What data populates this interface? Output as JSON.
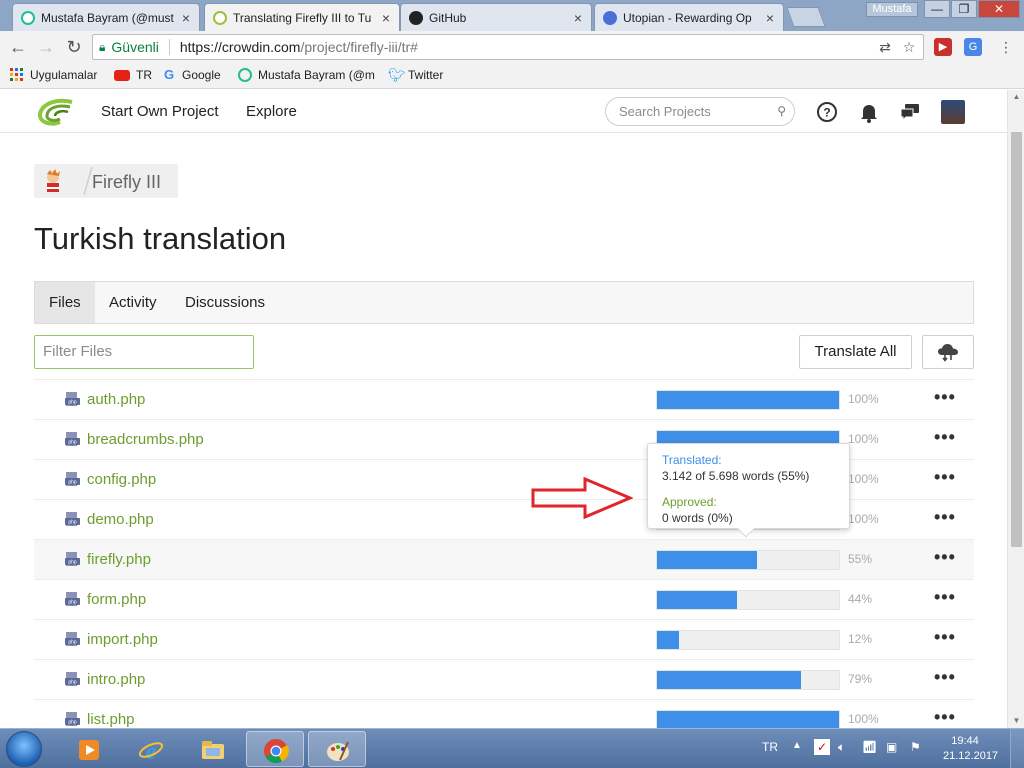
{
  "browser": {
    "tabs": [
      {
        "title": "Mustafa Bayram (@must",
        "favicon": "steemit-icon",
        "active": false
      },
      {
        "title": "Translating Firefly III to Tu",
        "favicon": "crowdin-icon",
        "active": true
      },
      {
        "title": "GitHub",
        "favicon": "github-icon",
        "active": false
      },
      {
        "title": "Utopian - Rewarding Op",
        "favicon": "utopian-icon",
        "active": false
      }
    ],
    "close_glyph": "×",
    "user_chip": "Mustafa",
    "window_buttons": [
      "—",
      "❐",
      "✕"
    ],
    "nav": {
      "back": "←",
      "forward": "→",
      "reload": "↻"
    },
    "address": {
      "secure_label": "Güvenli",
      "url_host": "https://crowdin.com",
      "url_path": "/project/firefly-iii/tr#"
    },
    "bookmarks": [
      {
        "label": "Uygulamalar",
        "icon": "apps-grid-icon"
      },
      {
        "label": "TR",
        "icon": "youtube-icon"
      },
      {
        "label": "Google",
        "icon": "google-icon"
      },
      {
        "label": "Mustafa Bayram (@m",
        "icon": "steemit-icon"
      },
      {
        "label": "Twitter",
        "icon": "twitter-icon"
      }
    ]
  },
  "site": {
    "nav": {
      "start_project": "Start Own Project",
      "explore": "Explore"
    },
    "search": {
      "placeholder": "Search Projects"
    },
    "breadcrumb": {
      "project": "Firefly III"
    },
    "page_title": "Turkish translation",
    "tabs": [
      {
        "label": "Files",
        "active": true
      },
      {
        "label": "Activity",
        "active": false
      },
      {
        "label": "Discussions",
        "active": false
      }
    ],
    "filter": {
      "placeholder": "Filter Files"
    },
    "translate_all": "Translate All",
    "files": [
      {
        "name": "auth.php",
        "progress": 100,
        "pct_label": "100%"
      },
      {
        "name": "breadcrumbs.php",
        "progress": 100,
        "pct_label": "100%"
      },
      {
        "name": "config.php",
        "progress": 100,
        "pct_label": "100%"
      },
      {
        "name": "demo.php",
        "progress": 100,
        "pct_label": "100%"
      },
      {
        "name": "firefly.php",
        "progress": 55,
        "pct_label": "55%"
      },
      {
        "name": "form.php",
        "progress": 44,
        "pct_label": "44%"
      },
      {
        "name": "import.php",
        "progress": 12,
        "pct_label": "12%"
      },
      {
        "name": "intro.php",
        "progress": 79,
        "pct_label": "79%"
      },
      {
        "name": "list.php",
        "progress": 100,
        "pct_label": "100%"
      }
    ],
    "more_glyph": "•••",
    "file_icon_text": "php",
    "tooltip": {
      "translated_label": "Translated:",
      "translated_value": "3.142 of 5.698 words (55%)",
      "approved_label": "Approved:",
      "approved_value": "0 words (0%)"
    }
  },
  "taskbar": {
    "language": "TR",
    "time": "19:44",
    "date": "21.12.2017",
    "apps": [
      "media-player-icon",
      "internet-explorer-icon",
      "file-explorer-icon",
      "chrome-icon",
      "paint-icon"
    ]
  },
  "colors": {
    "progress_fill": "#3f8ee8",
    "file_link": "#6c9e2f",
    "secure_green": "#0b8043",
    "annotation_arrow": "#e0262b"
  }
}
